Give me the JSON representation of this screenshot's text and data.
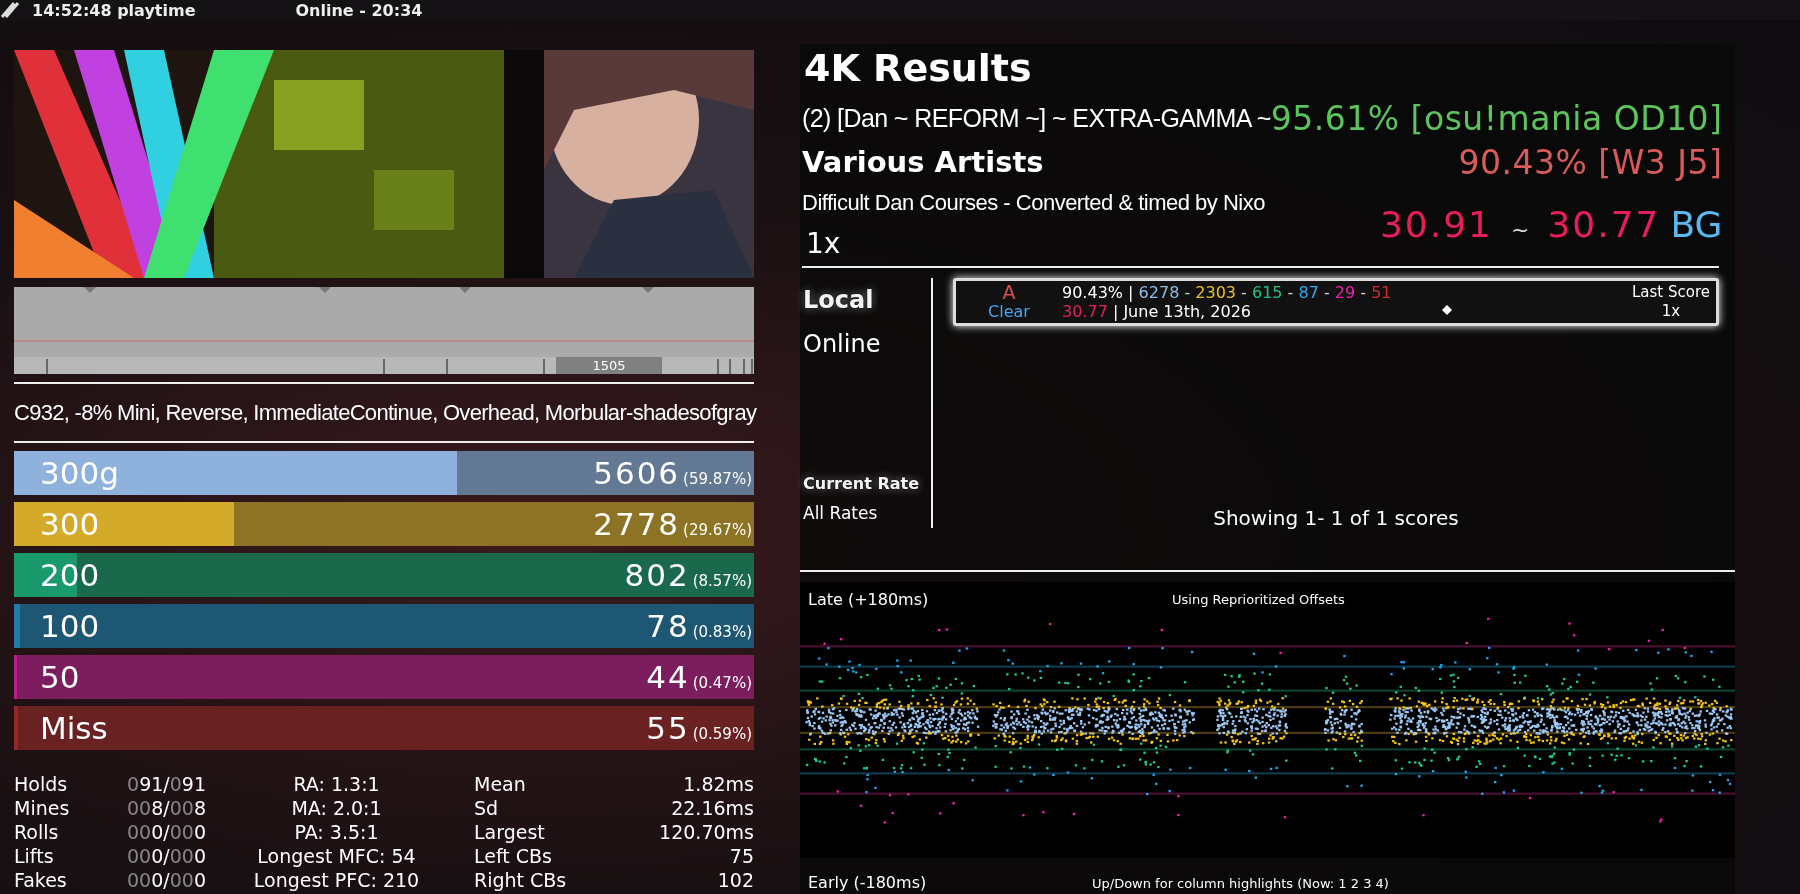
{
  "top_bar": {
    "playtime": "14:52:48 playtime",
    "online": "Online - 20:34"
  },
  "life_graph": {
    "marker_label": "1505"
  },
  "mods": "C932, -8% Mini, Reverse, ImmediateContinue, Overhead, Morbular-shadesofgray",
  "judgments": [
    {
      "name": "300g",
      "count": "5606",
      "percent": "(59.87%)",
      "level": 0.5987,
      "color": "#8fb2dc"
    },
    {
      "name": "300",
      "count": "2778",
      "percent": "(29.67%)",
      "level": 0.2967,
      "color": "#d4aa2a"
    },
    {
      "name": "200",
      "count": "802",
      "percent": "(8.57%)",
      "level": 0.0857,
      "color": "#1a9a6c"
    },
    {
      "name": "100",
      "count": "78",
      "percent": "(0.83%)",
      "level": 0.0083,
      "color": "#1f7cab"
    },
    {
      "name": "50",
      "count": "44",
      "percent": "(0.47%)",
      "level": 0.0047,
      "color": "#b81f88"
    },
    {
      "name": "Miss",
      "count": "55",
      "percent": "(0.59%)",
      "level": 0.0059,
      "color": "#9a2626"
    }
  ],
  "stats": {
    "counts": [
      {
        "label": "Holds",
        "value": "091/091"
      },
      {
        "label": "Mines",
        "value": "008/008"
      },
      {
        "label": "Rolls",
        "value": "000/000"
      },
      {
        "label": "Lifts",
        "value": "000/000"
      },
      {
        "label": "Fakes",
        "value": "000/000"
      }
    ],
    "ratios": [
      "RA: 1.3:1",
      "MA: 2.0:1",
      "PA: 3.5:1",
      "Longest MFC: 54",
      "Longest PFC: 210"
    ],
    "timing": [
      {
        "label": "Mean",
        "value": "1.82ms"
      },
      {
        "label": "Sd",
        "value": "22.16ms"
      },
      {
        "label": "Largest",
        "value": "120.70ms"
      },
      {
        "label": "Left CBs",
        "value": "75"
      },
      {
        "label": "Right CBs",
        "value": "102"
      }
    ]
  },
  "results": {
    "title": "4K Results",
    "song": "(2) [Dan ~ REFORM ~] ~ EXTRA-GAMMA ~",
    "artist": "Various Artists",
    "pack": "Difficult Dan Courses - Converted & timed by Nixo",
    "rate": "1x",
    "score_primary": "95.61% [osu!mania OD10]",
    "score_secondary": "90.43% [W3 J5]",
    "msd_from": "30.91",
    "msd_sep": "~",
    "msd_to": "30.77",
    "bg_label": "BG"
  },
  "scoreboard": {
    "sources": [
      {
        "label": "Local",
        "selected": true
      },
      {
        "label": "Online",
        "selected": false
      }
    ],
    "rates": [
      {
        "label": "Current Rate",
        "selected": true
      },
      {
        "label": "All Rates",
        "selected": false
      }
    ],
    "entries": [
      {
        "grade": "A",
        "clear": "Clear",
        "percent": "90.43%",
        "divider": "|",
        "separator": "-",
        "counts": [
          {
            "value": "6278",
            "color": "#8fbbe8"
          },
          {
            "value": "2303",
            "color": "#f0c020"
          },
          {
            "value": "615",
            "color": "#20c080"
          },
          {
            "value": "87",
            "color": "#30a8f0"
          },
          {
            "value": "29",
            "color": "#f020b0"
          },
          {
            "value": "51",
            "color": "#d02a2a"
          }
        ],
        "msd": "30.77",
        "date": "June 13th, 2026",
        "label": "Last Score",
        "rate": "1x"
      }
    ],
    "footer": "Showing 1- 1 of 1 scores"
  },
  "offset_plot": {
    "late_label": "Late (+180ms)",
    "mode_label": "Using Reprioritized Offsets",
    "early_label": "Early (-180ms)",
    "hint": "Up/Down for column highlights (Now:  1 2 3 4)"
  }
}
